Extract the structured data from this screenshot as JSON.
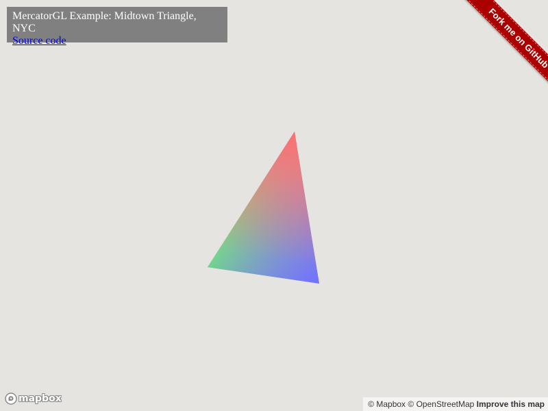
{
  "info": {
    "title": "MercatorGL Example: Midtown Triangle, NYC",
    "source_link": "Source code"
  },
  "ribbon": {
    "label": "Fork me on GitHub",
    "color": "#aa0000"
  },
  "map": {
    "background_color": "#e6e4e0",
    "triangle": {
      "vertex_colors": [
        "#ff7070",
        "#70f070",
        "#7070ff"
      ]
    }
  },
  "logo": {
    "text": "mapbox",
    "icon": "mapbox-logo-icon"
  },
  "attribution": {
    "mapbox": "© Mapbox",
    "osm": "© OpenStreetMap",
    "improve": "Improve this map"
  }
}
